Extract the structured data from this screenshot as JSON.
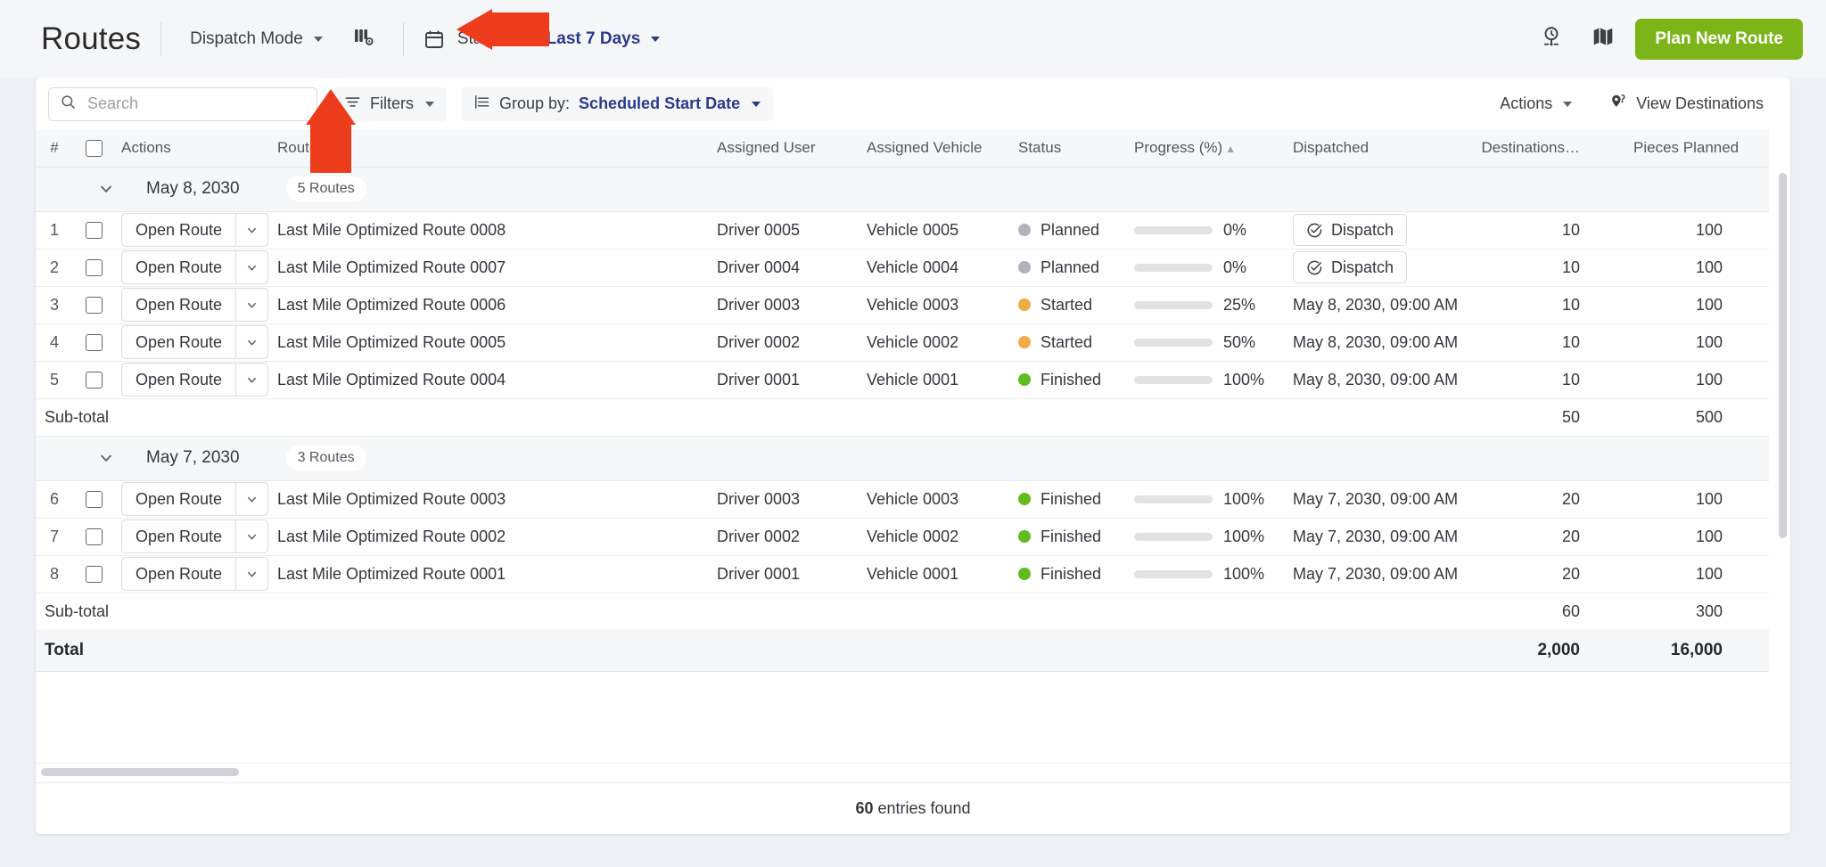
{
  "topbar": {
    "title": "Routes",
    "dispatch_mode": "Dispatch Mode",
    "columns_icon": "columns-settings-icon",
    "calendar_icon": "calendar-icon",
    "start_date_label": "Start Date:",
    "start_date_value": "Last 7 Days",
    "history_icon": "clock-pin-icon",
    "map_icon": "map-icon",
    "plan_new_route": "Plan New Route",
    "accent_green": "#7cb518",
    "link_blue": "#2a3a8c"
  },
  "toolbar": {
    "search_placeholder": "Search",
    "search_value": "",
    "search_icon": "search-icon",
    "filters_label": "Filters",
    "filters_icon": "filter-icon",
    "group_by_label": "Group by:",
    "group_by_value": "Scheduled Start Date",
    "group_by_icon": "group-list-icon",
    "actions_label": "Actions",
    "view_destinations_label": "View Destinations",
    "view_destinations_icon": "destination-pin-icon"
  },
  "table": {
    "headers": {
      "num": "#",
      "checkbox": "",
      "actions": "Actions",
      "route_name": "Route Na",
      "assigned_user": "Assigned User",
      "assigned_vehicle": "Assigned Vehicle",
      "status": "Status",
      "progress": "Progress (%)",
      "progress_sort": "▲",
      "dispatched": "Dispatched",
      "destinations": "Destinations…",
      "pieces_planned": "Pieces Planned"
    },
    "open_route_label": "Open Route",
    "dispatch_label": "Dispatch",
    "subtotal_label": "Sub-total",
    "total_label": "Total",
    "groups": [
      {
        "date": "May 8, 2030",
        "count_badge": "5 Routes",
        "rows": [
          {
            "num": "1",
            "route_name": "Last Mile Optimized Route 0008",
            "user": "Driver 0005",
            "vehicle": "Vehicle 0005",
            "status": "Planned",
            "status_color": "#b0b4ba",
            "progress": 0,
            "progress_label": "0%",
            "dispatched": "",
            "has_dispatch_button": true,
            "destinations": "10",
            "pieces": "100"
          },
          {
            "num": "2",
            "route_name": "Last Mile Optimized Route 0007",
            "user": "Driver 0004",
            "vehicle": "Vehicle 0004",
            "status": "Planned",
            "status_color": "#b0b4ba",
            "progress": 0,
            "progress_label": "0%",
            "dispatched": "",
            "has_dispatch_button": true,
            "destinations": "10",
            "pieces": "100"
          },
          {
            "num": "3",
            "route_name": "Last Mile Optimized Route 0006",
            "user": "Driver 0003",
            "vehicle": "Vehicle 0003",
            "status": "Started",
            "status_color": "#f0ac45",
            "progress": 25,
            "progress_label": "25%",
            "dispatched": "May 8, 2030, 09:00 AM",
            "has_dispatch_button": false,
            "destinations": "10",
            "pieces": "100"
          },
          {
            "num": "4",
            "route_name": "Last Mile Optimized Route 0005",
            "user": "Driver 0002",
            "vehicle": "Vehicle 0002",
            "status": "Started",
            "status_color": "#f0ac45",
            "progress": 50,
            "progress_label": "50%",
            "dispatched": "May 8, 2030, 09:00 AM",
            "has_dispatch_button": false,
            "destinations": "10",
            "pieces": "100"
          },
          {
            "num": "5",
            "route_name": "Last Mile Optimized Route 0004",
            "user": "Driver 0001",
            "vehicle": "Vehicle 0001",
            "status": "Finished",
            "status_color": "#62bb1f",
            "progress": 100,
            "progress_label": "100%",
            "dispatched": "May 8, 2030, 09:00 AM",
            "has_dispatch_button": false,
            "destinations": "10",
            "pieces": "100"
          }
        ],
        "subtotal_destinations": "50",
        "subtotal_pieces": "500"
      },
      {
        "date": "May 7, 2030",
        "count_badge": "3 Routes",
        "rows": [
          {
            "num": "6",
            "route_name": "Last Mile Optimized Route 0003",
            "user": "Driver 0003",
            "vehicle": "Vehicle 0003",
            "status": "Finished",
            "status_color": "#62bb1f",
            "progress": 100,
            "progress_label": "100%",
            "dispatched": "May 7, 2030, 09:00 AM",
            "has_dispatch_button": false,
            "destinations": "20",
            "pieces": "100"
          },
          {
            "num": "7",
            "route_name": "Last Mile Optimized Route 0002",
            "user": "Driver 0002",
            "vehicle": "Vehicle 0002",
            "status": "Finished",
            "status_color": "#62bb1f",
            "progress": 100,
            "progress_label": "100%",
            "dispatched": "May 7, 2030, 09:00 AM",
            "has_dispatch_button": false,
            "destinations": "20",
            "pieces": "100"
          },
          {
            "num": "8",
            "route_name": "Last Mile Optimized Route 0001",
            "user": "Driver 0001",
            "vehicle": "Vehicle 0001",
            "status": "Finished",
            "status_color": "#62bb1f",
            "progress": 100,
            "progress_label": "100%",
            "dispatched": "May 7, 2030, 09:00 AM",
            "has_dispatch_button": false,
            "destinations": "20",
            "pieces": "100"
          }
        ],
        "subtotal_destinations": "60",
        "subtotal_pieces": "300"
      }
    ],
    "total_destinations": "2,000",
    "total_pieces": "16,000"
  },
  "footer": {
    "entries_count": "60",
    "entries_suffix": " entries found"
  },
  "annotations": {
    "arrow_color": "#ec3c1c",
    "arrow_right_target": "start-date-filter",
    "arrow_up_target": "filters-button"
  }
}
